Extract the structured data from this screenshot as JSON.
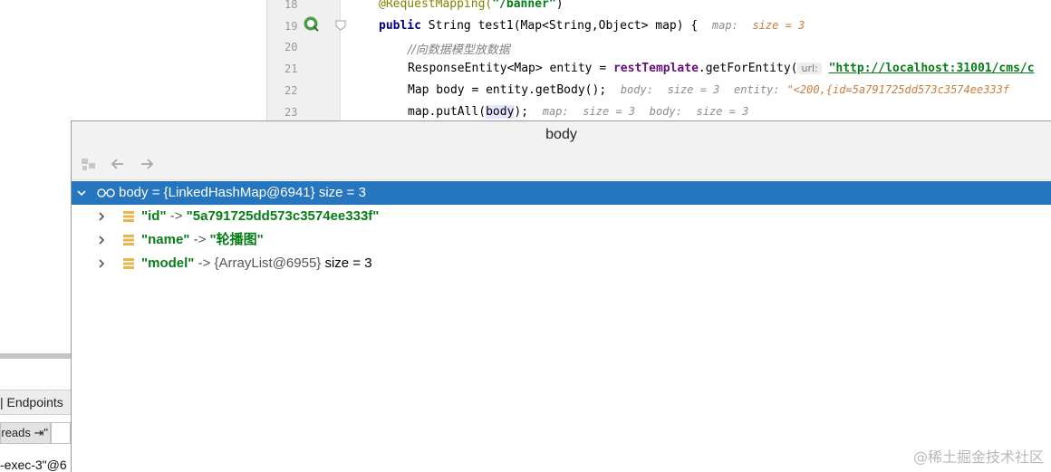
{
  "editor": {
    "line_numbers": [
      "18",
      "19",
      "20",
      "21",
      "22",
      "23"
    ],
    "lines": {
      "l18": {
        "annotation": "@RequestMapping(",
        "string": "\"/banner\"",
        "close": ")"
      },
      "l19": {
        "keyword": "public",
        "code": " String test1(Map<String,Object> map) {",
        "hint_key": "map:",
        "hint_val": "size = 3"
      },
      "l20": {
        "comment": "//向数据模型放数据"
      },
      "l21": {
        "code_a": "ResponseEntity<Map> entity = ",
        "field": "restTemplate",
        "code_b": ".getForEntity(",
        "inlay": "url:",
        "string": "\"http://localhost:31001/cms/c"
      },
      "l22": {
        "code": "Map body = entity.getBody();",
        "hint_a_key": "body:",
        "hint_a_val": "size = 3",
        "hint_b_key": "entity:",
        "hint_b_val": "\"<200,{id=5a791725dd573c3574ee333f"
      },
      "l23": {
        "code_a": "map.putAll(",
        "highlight": "body",
        "code_b": ");",
        "hint_a_key": "map:",
        "hint_a_val": "size = 3",
        "hint_b_key": "body:",
        "hint_b_val": "size = 3"
      }
    }
  },
  "popup": {
    "title": "body",
    "toolbar": {
      "inspect_icon": "object-inspect-icon",
      "back_icon": "arrow-left-icon",
      "forward_icon": "arrow-right-icon"
    },
    "root": {
      "name": "body",
      "eq": " = ",
      "value": "{LinkedHashMap@6941}",
      "size": " size = 3",
      "icon": "watch-glasses-icon"
    },
    "entries": [
      {
        "key": "\"id\"",
        "arrow": " -> ",
        "value": "\"5a791725dd573c3574ee333f\"",
        "value_type": "string",
        "size": ""
      },
      {
        "key": "\"name\"",
        "arrow": " -> ",
        "value": "\"轮播图\"",
        "value_type": "string",
        "size": ""
      },
      {
        "key": "\"model\"",
        "arrow": " -> ",
        "value": "{ArrayList@6955}",
        "value_type": "object",
        "size": " size = 3"
      }
    ]
  },
  "ide_left": {
    "endpoints_tab": "| Endpoints",
    "threads_label": "reads ⇥\"",
    "exec_text": "-exec-3\"@6"
  },
  "watermark": "@稀土掘金技术社区",
  "colors": {
    "selection": "#2675bf",
    "string_green": "#067d17",
    "hint_value_orange": "#c77d3c",
    "field_purple": "#660e7a",
    "keyword_navy": "#000080"
  }
}
